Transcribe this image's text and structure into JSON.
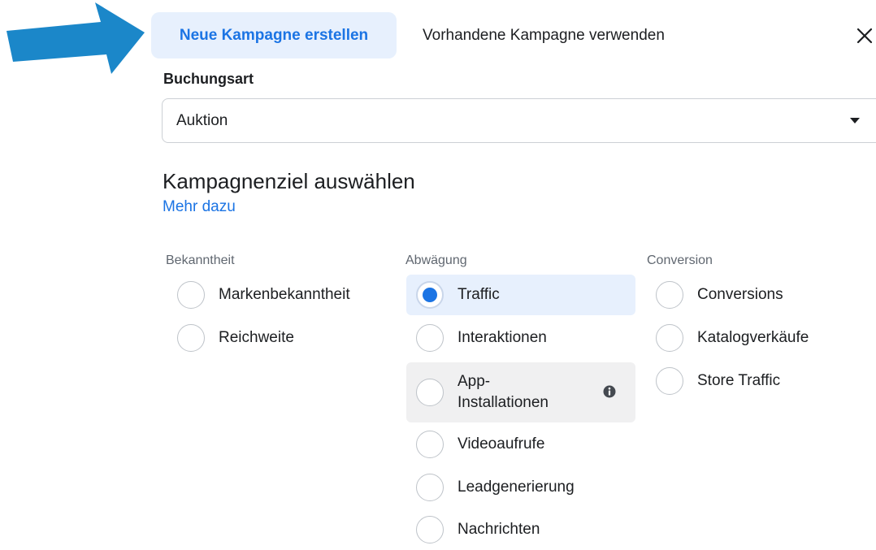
{
  "tabs": {
    "new_campaign": "Neue Kampagne erstellen",
    "existing_campaign": "Vorhandene Kampagne verwenden"
  },
  "close_icon": "close-icon",
  "booking": {
    "label": "Buchungsart",
    "value": "Auktion"
  },
  "objective": {
    "title": "Kampagnenziel auswählen",
    "learn_more": "Mehr dazu"
  },
  "groups": {
    "awareness": {
      "label": "Bekanntheit",
      "options": [
        "Markenbekanntheit",
        "Reichweite"
      ]
    },
    "consideration": {
      "label": "Abwägung",
      "options": [
        "Traffic",
        "Interaktionen",
        "App-Installationen",
        "Videoaufrufe",
        "Leadgenerierung",
        "Nachrichten"
      ],
      "selected": "Traffic"
    },
    "conversion": {
      "label": "Conversion",
      "options": [
        "Conversions",
        "Katalogverkäufe",
        "Store Traffic"
      ]
    }
  },
  "colors": {
    "accent": "#1b74e4",
    "selected_bg": "#e7f0fd",
    "arrow": "#1b87c9"
  }
}
